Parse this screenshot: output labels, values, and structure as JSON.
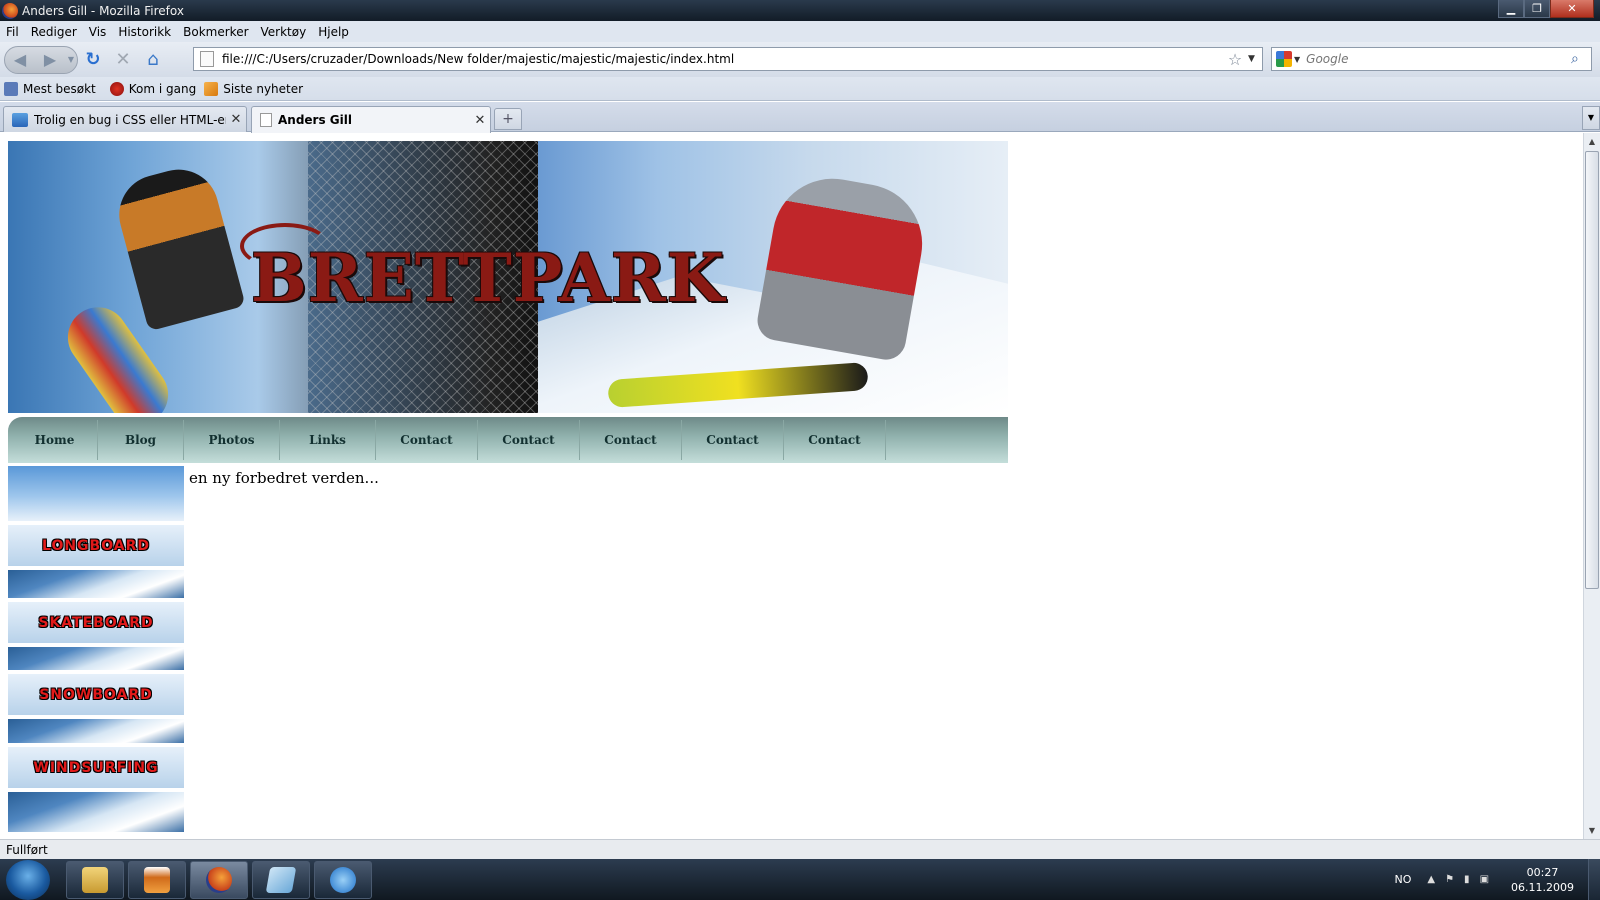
{
  "window": {
    "title": "Anders Gill - Mozilla Firefox"
  },
  "menu": [
    "Fil",
    "Rediger",
    "Vis",
    "Historikk",
    "Bokmerker",
    "Verktøy",
    "Hjelp"
  ],
  "navbar": {
    "url": "file:///C:/Users/cruzader/Downloads/New folder/majestic/majestic/majestic/index.html",
    "search_placeholder": "Google"
  },
  "bookmarks": [
    "Mest besøkt",
    "Kom i gang",
    "Siste nyheter"
  ],
  "tabs": [
    {
      "label": "Trolig en bug i CSS eller HTML-en -...",
      "active": false
    },
    {
      "label": "Anders Gill",
      "active": true
    }
  ],
  "page": {
    "banner_logo": "BRETTPARK",
    "nav": [
      "Home",
      "Blog",
      "Photos",
      "Links",
      "Contact",
      "Contact",
      "Contact",
      "Contact",
      "Contact"
    ],
    "sidebar": [
      "LONGBOARD",
      "SKATEBOARD",
      "SNOWBOARD",
      "WINDSURFING"
    ],
    "content_text": "en ny forbedret verden..."
  },
  "status": "Fullført",
  "taskbar": {
    "language": "NO",
    "time": "00:27",
    "date": "06.11.2009"
  },
  "colors": {
    "nav_gradient_top": "#6e8a88",
    "nav_gradient_bottom": "#c4deda",
    "sidebar_label": "#e21a1a",
    "logo": "#8a1a14"
  }
}
